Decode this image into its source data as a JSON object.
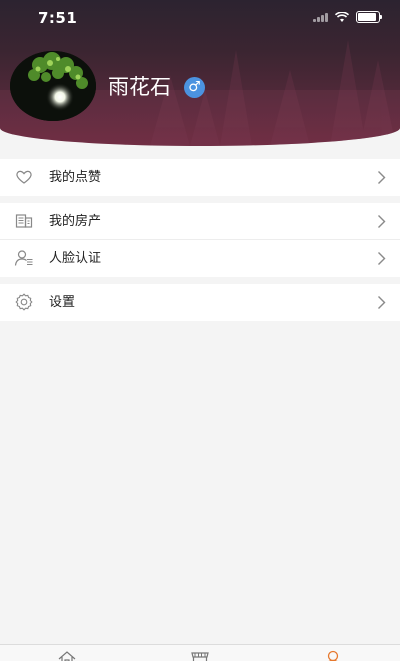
{
  "status": {
    "time": "7:51"
  },
  "profile": {
    "name": "雨花石",
    "gender": "♂"
  },
  "menu": [
    {
      "label": "我的点赞",
      "icon": "heart-icon"
    },
    {
      "label": "我的房产",
      "icon": "building-icon"
    },
    {
      "label": "人脸认证",
      "icon": "face-verify-icon"
    },
    {
      "label": "设置",
      "icon": "gear-icon"
    }
  ],
  "tabs": [
    {
      "icon": "home-icon",
      "active": false
    },
    {
      "icon": "shop-icon",
      "active": false
    },
    {
      "icon": "profile-icon",
      "active": true
    }
  ],
  "colors": {
    "header_top": "#2c2330",
    "header_bottom": "#6a2a3f",
    "gender_badge": "#4b93e0",
    "tab_active": "#e6782d",
    "tab_inactive": "#777777"
  }
}
